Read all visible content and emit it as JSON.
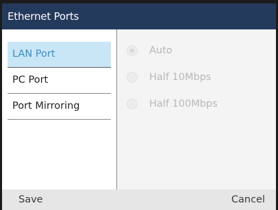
{
  "header": {
    "title": "Ethernet Ports"
  },
  "menu": {
    "items": [
      {
        "label": "LAN Port",
        "selected": true
      },
      {
        "label": "PC Port",
        "selected": false
      },
      {
        "label": "Port Mirroring",
        "selected": false
      }
    ]
  },
  "options": {
    "items": [
      {
        "label": "Auto",
        "checked": true
      },
      {
        "label": "Half 10Mbps",
        "checked": false
      },
      {
        "label": "Half 100Mbps",
        "checked": false
      }
    ]
  },
  "softkeys": {
    "left": "Save",
    "right": "Cancel"
  },
  "colors": {
    "title_bar": "#243a5c",
    "selected_bg": "#c9e6f7",
    "selected_text": "#3a8fc4",
    "disabled_text": "#b8b8b8",
    "softkey_bar": "#e6e6e6"
  }
}
